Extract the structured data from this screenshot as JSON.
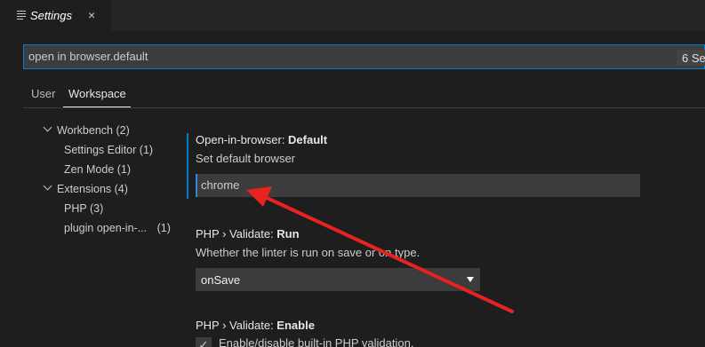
{
  "tab": {
    "title": "Settings",
    "close": "×"
  },
  "search": {
    "value": "open in browser.default",
    "count": "6 Se"
  },
  "scope_tabs": {
    "user": "User",
    "workspace": "Workspace"
  },
  "toc": [
    {
      "label": "Workbench",
      "count": "(2)"
    },
    {
      "label": "Settings Editor",
      "count": "(1)"
    },
    {
      "label": "Zen Mode",
      "count": "(1)"
    },
    {
      "label": "Extensions",
      "count": "(4)"
    },
    {
      "label": "PHP",
      "count": "(3)"
    },
    {
      "label": "plugin open-in-...",
      "count": "(1)"
    }
  ],
  "settings": {
    "browser": {
      "category": "Open-in-browser: ",
      "name": "Default",
      "description": "Set default browser",
      "value": "chrome"
    },
    "validate_run": {
      "category": "PHP › Validate: ",
      "name": "Run",
      "description": "Whether the linter is run on save or on type.",
      "value": "onSave"
    },
    "validate_enable": {
      "category": "PHP › Validate: ",
      "name": "Enable",
      "description": "Enable/disable built-in PHP validation.",
      "checked": "✓"
    }
  },
  "colors": {
    "accent": "#007acc",
    "annotation_arrow": "#e8231f"
  }
}
